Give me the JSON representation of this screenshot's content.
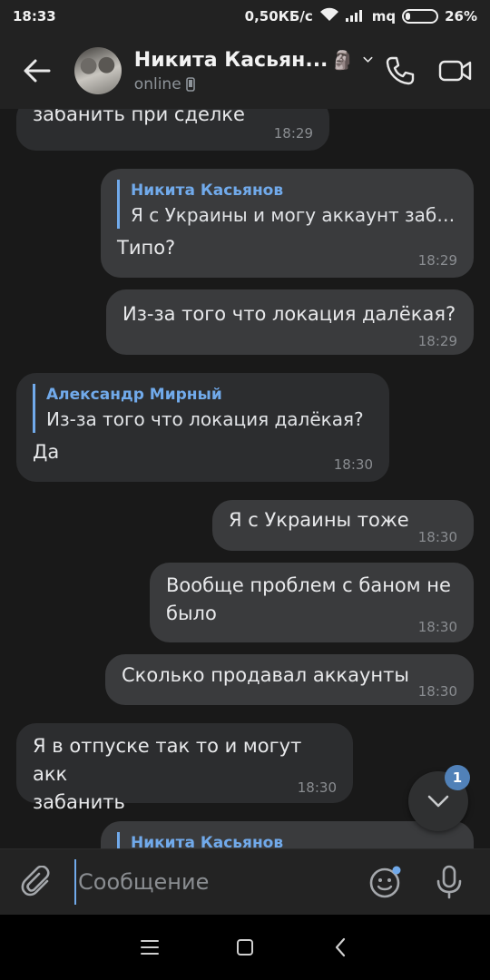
{
  "status_bar": {
    "time": "18:33",
    "network_speed": "0,50КБ/с",
    "carrier": "mq",
    "battery_percent": "26%",
    "battery_level": 0.26
  },
  "header": {
    "contact_name": "Никита Касьян...",
    "name_emoji": "🗿",
    "status": "online"
  },
  "messages": [
    {
      "direction": "in",
      "text": "забанить при сделке",
      "time": "18:29"
    },
    {
      "direction": "out",
      "reply_name": "Никита Касьянов",
      "reply_text": "Я с Украины и могу аккаунт заба...",
      "text": "Типо?",
      "time": "18:29"
    },
    {
      "direction": "out",
      "text": "Из-за того что локация далёкая?",
      "time": "18:29"
    },
    {
      "direction": "in",
      "reply_name": "Александр Мирный",
      "reply_text": "Из-за того что локация далёкая?",
      "text": "Да",
      "time": "18:30"
    },
    {
      "direction": "out",
      "text": "Я с Украины тоже",
      "time": "18:30"
    },
    {
      "direction": "out",
      "text": "Вообще проблем с баном не\nбыло",
      "time": "18:30"
    },
    {
      "direction": "out",
      "text": "Сколько продавал аккаунты",
      "time": "18:30"
    },
    {
      "direction": "in",
      "text": "Я в отпуске так то и могут акк\nзабанить",
      "time": "18:30"
    },
    {
      "direction": "out",
      "reply_name": "Никита Касьянов"
    }
  ],
  "scroll_badge": "1",
  "composer": {
    "placeholder": "Сообщение"
  },
  "colors": {
    "accent": "#71aaeb",
    "badge": "#5181b8",
    "bubble_in": "#2c2d2f",
    "bubble_out": "#3a3b3d",
    "background": "#191919"
  }
}
